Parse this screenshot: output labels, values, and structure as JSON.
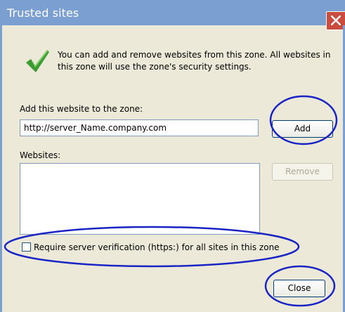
{
  "window": {
    "title": "Trusted sites"
  },
  "intro": {
    "text": "You can add and remove websites from this zone. All websites in this zone will use the zone's security settings."
  },
  "add_site": {
    "label": "Add this website to the zone:",
    "value": "http://server_Name.company.com",
    "add_label": "Add"
  },
  "websites": {
    "label": "Websites:",
    "items": [],
    "remove_label": "Remove"
  },
  "https_option": {
    "label": "Require server verification (https:) for all sites in this zone",
    "checked": false
  },
  "footer": {
    "close_label": "Close"
  },
  "icons": {
    "check": "green-checkmark-icon",
    "close": "close-x-icon"
  },
  "colors": {
    "titlebar": "#7b9fd1",
    "annotation": "#1a24c4",
    "check": "#3c9a32"
  }
}
